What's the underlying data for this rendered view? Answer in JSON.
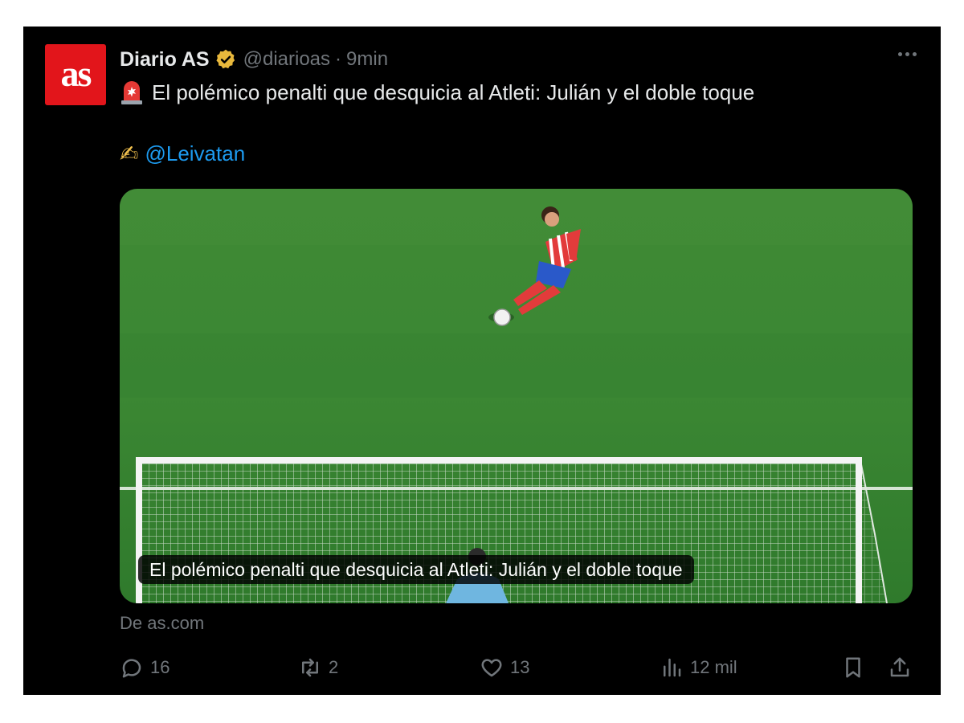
{
  "account": {
    "avatar_text": "as",
    "name": "Diario AS",
    "handle": "@diarioas",
    "separator": "·",
    "time": "9min"
  },
  "tweet": {
    "text": "El polémico penalti que desquicia al Atleti: Julián y el doble toque",
    "mention": "@Leivatan",
    "emoji_writing": "✍"
  },
  "media": {
    "caption": "El polémico penalti que desquicia al Atleti: Julián y el doble toque"
  },
  "source": "De as.com",
  "actions": {
    "replies": "16",
    "reposts": "2",
    "likes": "13",
    "views": "12 mil"
  },
  "icons": {
    "more": "more-dots-icon",
    "verified": "verified-badge-icon",
    "siren": "police-light-icon",
    "reply": "reply-icon",
    "repost": "repost-icon",
    "like": "heart-icon",
    "views": "views-chart-icon",
    "bookmark": "bookmark-icon",
    "share": "share-icon"
  },
  "colors": {
    "background": "#000000",
    "text_primary": "#e7e9ea",
    "text_secondary": "#71767b",
    "link": "#1d9bf0",
    "brand_red": "#e2151b",
    "verified_gold": "#e8b83c"
  }
}
